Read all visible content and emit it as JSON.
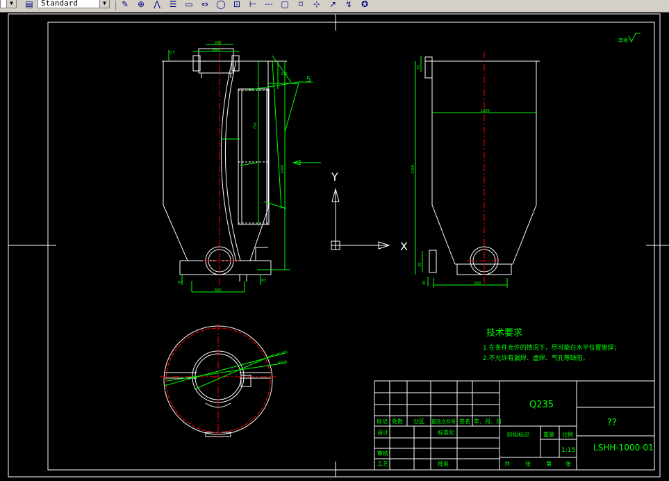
{
  "toolbar": {
    "textstyle_value": "Standard",
    "tools": [
      "dimension-linear-icon",
      "dimension-aligned-icon",
      "dimension-ordinate-icon",
      "dimension-radius-icon",
      "dimension-baseline-icon",
      "dimension-continue-icon",
      "dimension-center-icon",
      "dimension-angular-icon",
      "dimension-quick-icon",
      "dimension-leader-icon",
      "tolerance-icon",
      "center-mark-icon",
      "dimension-edit-icon",
      "dimension-text-edit-icon",
      "dimension-update-icon",
      "dimension-style-icon"
    ]
  },
  "drawing": {
    "note_5": "5",
    "axis_y": "Y",
    "axis_x": "X",
    "roughness_note": "其余",
    "tech_req": {
      "title": "技术要求",
      "line1": "1.在条件允许的情况下，尽可能在水平位置施焊；",
      "line2": "2.不允许有漏焊、虚焊、气孔等缺陷。"
    },
    "title_block": {
      "material": "Q235",
      "name": "??",
      "drawing_no": "LSHH-1000-01",
      "scale": "1:15",
      "headers": [
        "标记",
        "处数",
        "分区",
        "更改文件号",
        "签名",
        "年、月、日"
      ],
      "design": "设计",
      "standardize": "标准化",
      "stage_mark": "阶段标记",
      "weight": "重量",
      "scale_label": "比例",
      "review": "审核",
      "process": "工艺",
      "approve": "批准",
      "sheets_total": "共",
      "sheets_label": "张",
      "sheet_no": "第",
      "sheet_label": "张"
    },
    "colors": {
      "outline": "#ffffff",
      "centerline": "#ff0000",
      "dimension": "#00ff00",
      "crosshair": "#ffffff",
      "background": "#000000"
    }
  }
}
